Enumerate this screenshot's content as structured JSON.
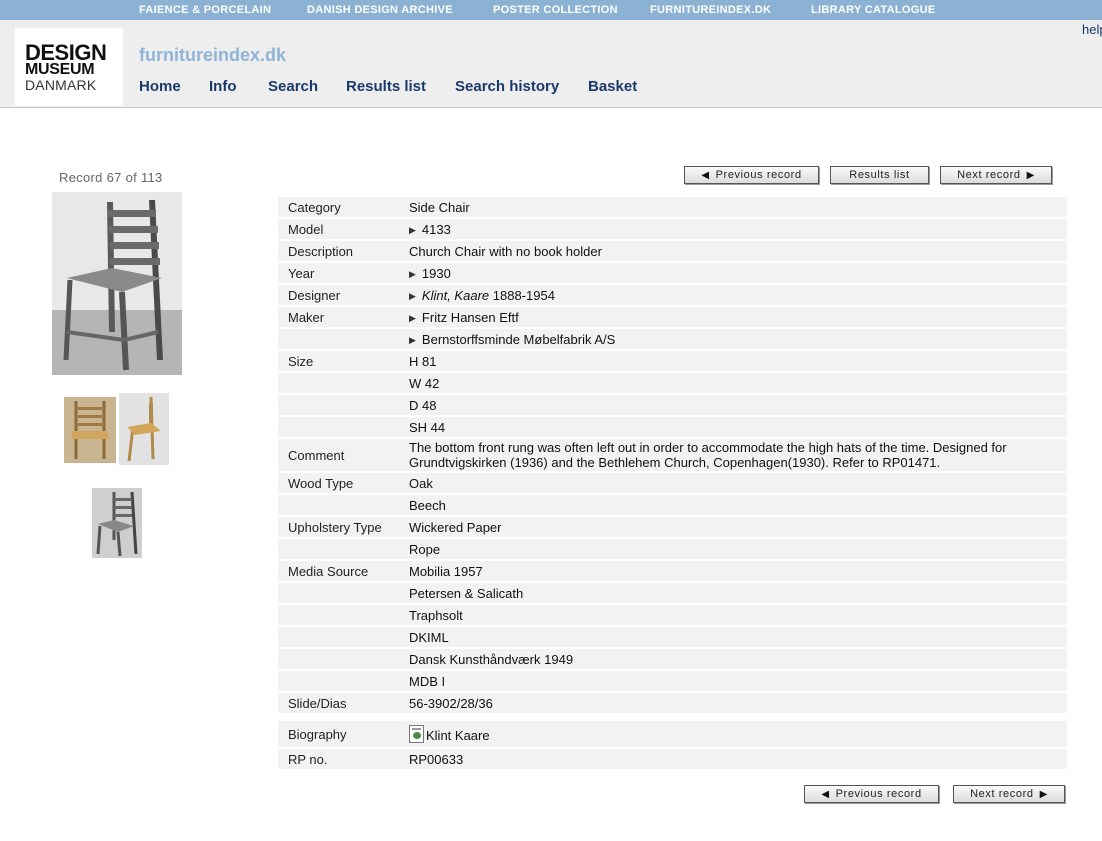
{
  "top_links": [
    "FAIENCE & PORCELAIN",
    "DANISH DESIGN ARCHIVE",
    "POSTER COLLECTION",
    "FURNITUREINDEX.DK",
    "LIBRARY CATALOGUE"
  ],
  "help_link": "help",
  "logo": {
    "line1": "DESIGN",
    "line2": "MUSEUM",
    "line3": "DANMARK"
  },
  "site_name": "furnitureindex.dk",
  "nav": [
    "Home",
    "Info",
    "Search",
    "Results list",
    "Search history",
    "Basket"
  ],
  "record_counter": "Record 67 of 113",
  "buttons": {
    "previous_record": "Previous record",
    "results_list": "Results list",
    "next_record": "Next record"
  },
  "fields": {
    "category": {
      "label": "Category",
      "value": "Side Chair"
    },
    "model": {
      "label": "Model",
      "value": "4133"
    },
    "description": {
      "label": "Description",
      "value": "Church Chair with no book holder"
    },
    "year": {
      "label": "Year",
      "value": "1930"
    },
    "designer": {
      "label": "Designer",
      "name": "Klint, Kaare",
      "dates": "1888-1954"
    },
    "maker": {
      "label": "Maker",
      "values": [
        "Fritz Hansen Eftf",
        "Bernstorffsminde Møbelfabrik A/S"
      ]
    },
    "size": {
      "label": "Size",
      "values": [
        "H 81",
        "W 42",
        "D 48",
        "SH 44"
      ]
    },
    "comment": {
      "label": "Comment",
      "value": "The bottom front rung was often left out in order to accommodate the high hats of the time. Designed for Grundtvigskirken (1936) and the Bethlehem Church, Copenhagen(1930). Refer to RP01471."
    },
    "wood_type": {
      "label": "Wood Type",
      "values": [
        "Oak",
        "Beech"
      ]
    },
    "upholstery_type": {
      "label": "Upholstery Type",
      "values": [
        "Wickered Paper",
        "Rope"
      ]
    },
    "media_source": {
      "label": "Media Source",
      "values": [
        "Mobilia 1957",
        "Petersen & Salicath",
        "Traphsolt",
        "DKIML",
        "Dansk Kunsthåndværk 1949",
        "MDB I"
      ]
    },
    "slide": {
      "label": "Slide/Dias",
      "value": "56-3902/28/36"
    },
    "biography": {
      "label": "Biography",
      "value": "Klint Kaare"
    },
    "rp_no": {
      "label": "RP no.",
      "value": "RP00633"
    }
  }
}
